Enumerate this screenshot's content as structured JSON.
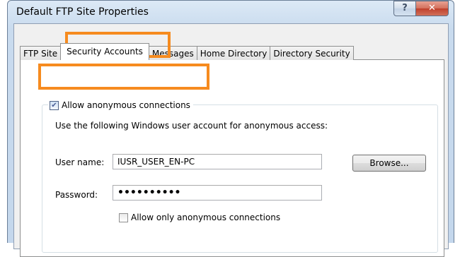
{
  "window": {
    "title": "Default FTP Site Properties",
    "help_glyph": "?",
    "close_glyph": "✕"
  },
  "tabs": [
    {
      "label": "FTP Site",
      "active": false
    },
    {
      "label": "Security Accounts",
      "active": true
    },
    {
      "label": "Messages",
      "active": false
    },
    {
      "label": "Home Directory",
      "active": false
    },
    {
      "label": "Directory Security",
      "active": false
    }
  ],
  "security": {
    "allow_anonymous_label": "Allow anonymous connections",
    "allow_anonymous_checked": true,
    "instructions": "Use the following Windows user account for anonymous access:",
    "username_label": "User name:",
    "username_value": "IUSR_USER_EN-PC",
    "browse_label": "Browse...",
    "password_label": "Password:",
    "password_value": "••••••••••",
    "allow_only_anonymous_label": "Allow only anonymous connections",
    "allow_only_anonymous_checked": false
  },
  "colors": {
    "highlight": "#f68b1f"
  }
}
